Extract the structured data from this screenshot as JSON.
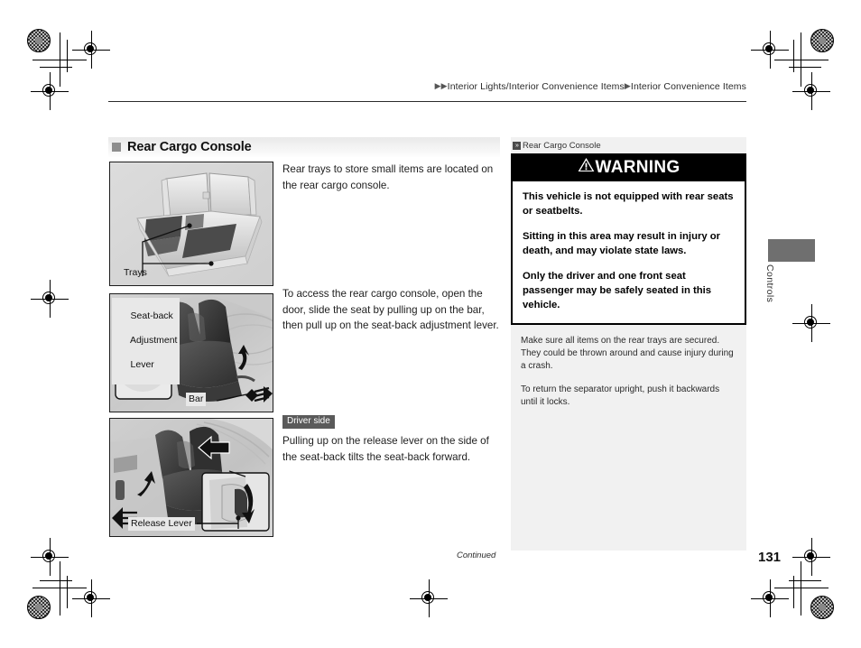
{
  "breadcrumb": {
    "arrow": "▶",
    "part1": "Interior Lights/Interior Convenience Items",
    "part2": "Interior Convenience Items"
  },
  "section": {
    "title": "Rear Cargo Console"
  },
  "main": {
    "paragraph1": "Rear trays to store small items are located on the rear cargo console.",
    "paragraph2": "To access the rear cargo console, open the door, slide the seat by pulling up on the bar, then pull up on the seat-back adjustment lever.",
    "driver_side_badge": "Driver side",
    "paragraph3": "Pulling up on the release lever on the side of the seat-back tilts the seat-back forward."
  },
  "figures": {
    "fig1_label_trays": "Trays",
    "fig2_label_lever_line1": "Seat-back",
    "fig2_label_lever_line2": "Adjustment",
    "fig2_label_lever_line3": "Lever",
    "fig2_label_bar": "Bar",
    "fig3_label_release": "Release Lever"
  },
  "sidebar": {
    "reference_icon": "»",
    "reference_label": "Rear Cargo Console",
    "warning": {
      "triangle_icon": "⚠",
      "title": "WARNING",
      "paragraphs": [
        "This vehicle is not equipped with rear seats or seatbelts.",
        "Sitting in this area may result in injury or death, and may violate state laws.",
        "Only the driver and one front seat passenger may be safely seated in this vehicle."
      ]
    },
    "notes": [
      "Make sure all items on the rear trays are secured. They could be thrown around and cause injury during a crash.",
      "To return the separator upright, push it backwards until it locks."
    ]
  },
  "side_tab": {
    "label": "Controls"
  },
  "footer": {
    "continued": "Continued",
    "page_number": "131"
  },
  "colors": {
    "warning_header_bg": "#000000",
    "sidebar_bg": "#f1f1f1",
    "badge_bg": "#5a5a5a",
    "section_bullet": "#8e8e8e",
    "side_tab": "#6f6f6f"
  }
}
